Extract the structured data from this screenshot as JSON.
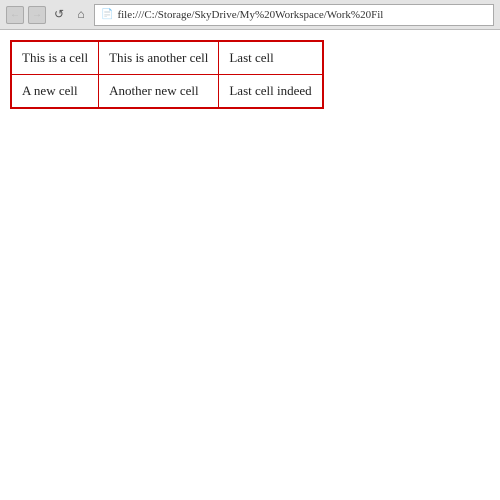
{
  "browser": {
    "address": "file:///C:/Storage/SkyDrive/My%20Workspace/Work%20Fil",
    "back_label": "←",
    "forward_label": "→",
    "reload_label": "↺",
    "home_label": "⌂"
  },
  "table": {
    "rows": [
      [
        "This is a cell",
        "This is another cell",
        "Last cell"
      ],
      [
        "A new cell",
        "Another new cell",
        "Last cell indeed"
      ]
    ]
  }
}
